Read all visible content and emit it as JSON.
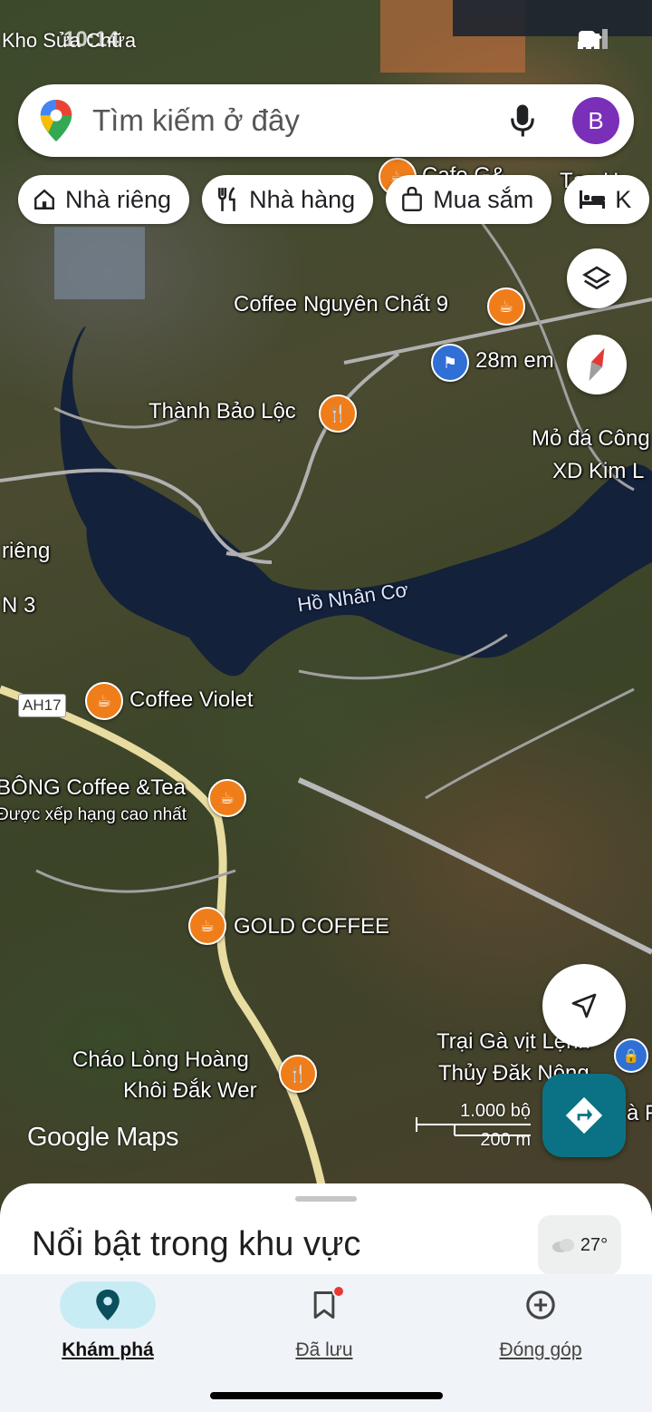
{
  "status_bar": {
    "carrier_label": "Kho Sửa Chữa",
    "time": "10:14"
  },
  "search": {
    "placeholder": "Tìm kiếm ở đây",
    "avatar_letter": "B",
    "logo_icon": "google-maps-pin-icon",
    "mic_icon": "mic-icon"
  },
  "chips": [
    {
      "label": "Nhà riêng",
      "icon": "home-icon"
    },
    {
      "label": "Nhà hàng",
      "icon": "restaurant-icon"
    },
    {
      "label": "Mua sắm",
      "icon": "shopping-bag-icon"
    },
    {
      "label": "K",
      "icon": "hotel-icon"
    }
  ],
  "map": {
    "places": [
      {
        "name": "Cafe G&",
        "type": "cafe"
      },
      {
        "name": "Tạp H",
        "type": "store"
      },
      {
        "name": "Coffee Nguyên Chất 9",
        "type": "cafe"
      },
      {
        "name": "28m em",
        "type": "flag"
      },
      {
        "name": "Thành Bảo Lộc",
        "type": "restaurant"
      },
      {
        "name": "Mỏ đá Công",
        "type": "place"
      },
      {
        "name": "XD Kim L",
        "type": "place"
      },
      {
        "name": "riêng",
        "type": "place"
      },
      {
        "name": "N 3",
        "type": "place"
      },
      {
        "name": "Coffee Violet",
        "type": "cafe"
      },
      {
        "name": "BÔNG Coffee &Tea",
        "type": "cafe",
        "subtitle": "Được xếp hạng cao nhất"
      },
      {
        "name": "GOLD COFFEE",
        "type": "cafe"
      },
      {
        "name": "Trại Gà vịt Lệnh",
        "type": "place"
      },
      {
        "name": "Thủy Đăk Nông",
        "type": "place"
      },
      {
        "name": "Cháo Lòng Hoàng",
        "type": "restaurant"
      },
      {
        "name": "Khôi Đắk Wer",
        "type": "restaurant"
      },
      {
        "name": "à F",
        "type": "place"
      }
    ],
    "lake_label": "Hồ Nhân Cơ",
    "road_shield": "AH17",
    "brand": "Google Maps",
    "scale": {
      "imperial": "1.000 bộ",
      "metric": "200 m"
    }
  },
  "sheet": {
    "title": "Nổi bật trong khu vực",
    "temperature": "27°"
  },
  "nav": [
    {
      "label": "Khám phá",
      "icon": "explore-pin-icon",
      "active": true
    },
    {
      "label": "Đã lưu",
      "icon": "bookmark-icon",
      "active": false
    },
    {
      "label": "Đóng góp",
      "icon": "add-circle-icon",
      "active": false
    }
  ],
  "colors": {
    "accent": "#0b7285",
    "poi_orange": "#ef7d1a",
    "poi_blue": "#2f6fd6",
    "avatar": "#7a2fb8"
  }
}
